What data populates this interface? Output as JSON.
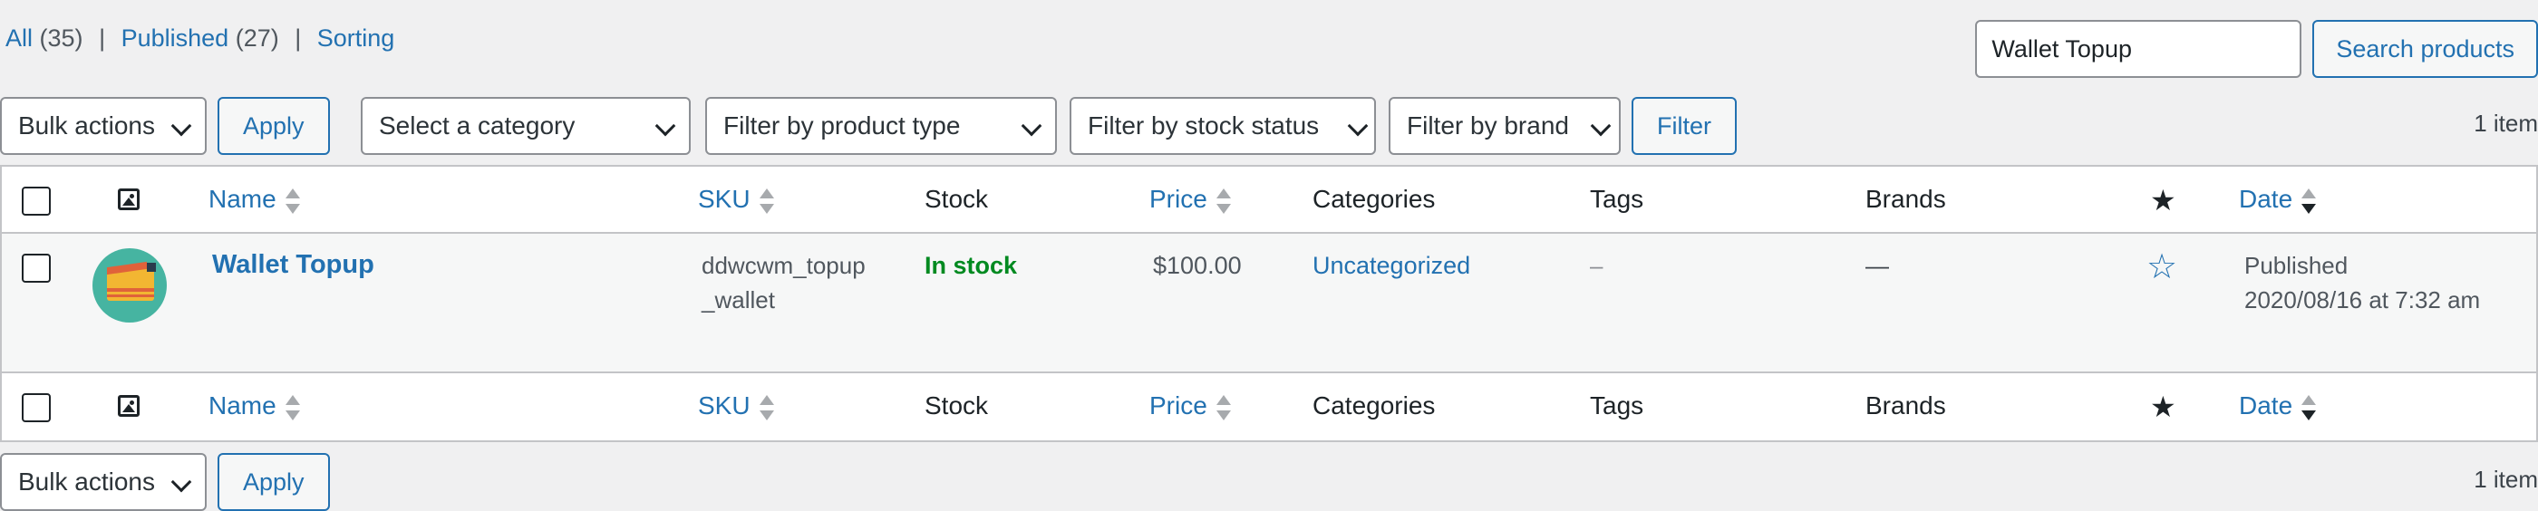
{
  "status_links": [
    {
      "label": "All",
      "count": "(35)"
    },
    {
      "label": "Published",
      "count": "(27)"
    },
    {
      "label": "Sorting",
      "count": ""
    }
  ],
  "separator": "|",
  "search": {
    "value": "Wallet Topup",
    "button": "Search products"
  },
  "top_nav": {
    "bulk_actions": "Bulk actions",
    "apply": "Apply",
    "category": "Select a category",
    "product_type": "Filter by product type",
    "stock_status": "Filter by stock status",
    "brand": "Filter by brand",
    "filter": "Filter",
    "count": "1 item"
  },
  "bottom_nav": {
    "bulk_actions": "Bulk actions",
    "apply": "Apply",
    "count": "1 item"
  },
  "columns": {
    "name": "Name",
    "sku": "SKU",
    "stock": "Stock",
    "price": "Price",
    "categories": "Categories",
    "tags": "Tags",
    "brands": "Brands",
    "featured_icon": "star-icon",
    "date": "Date"
  },
  "rows": [
    {
      "name": "Wallet Topup",
      "sku_line1": "ddwcwm_topup",
      "sku_line2": "_wallet",
      "stock": "In stock",
      "price": "$100.00",
      "category": "Uncategorized",
      "tags": "–",
      "brands": "—",
      "date_status": "Published",
      "date_value": "2020/08/16 at 7:32 am",
      "featured": false
    }
  ],
  "colors": {
    "link": "#2271b1",
    "in_stock": "#008a20",
    "background": "#f0f0f1"
  }
}
